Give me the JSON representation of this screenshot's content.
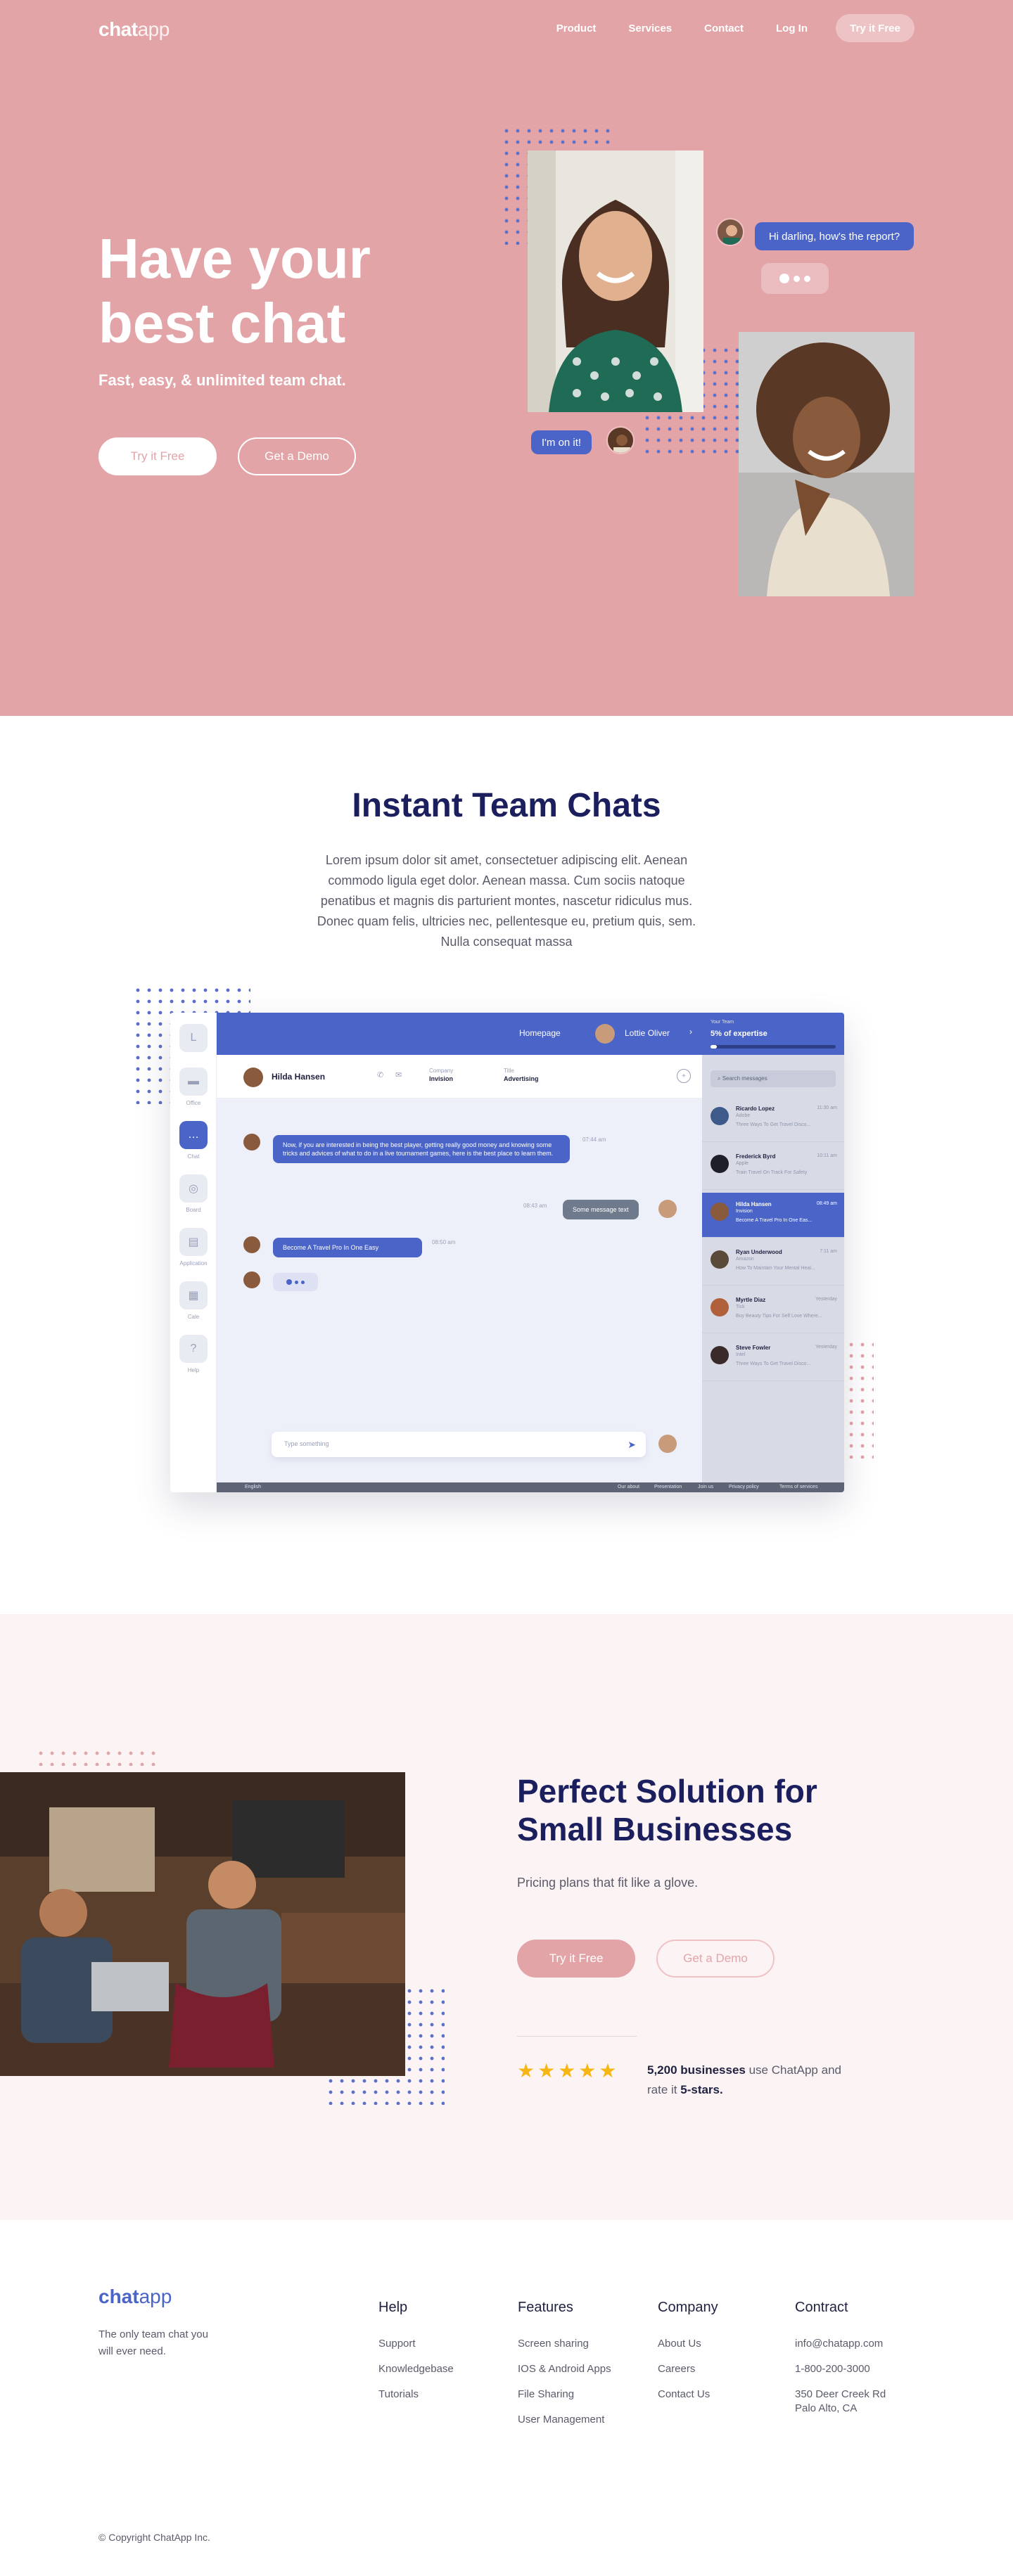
{
  "nav": {
    "logo_bold": "chat",
    "logo_light": "app",
    "links": [
      "Product",
      "Services",
      "Contact",
      "Log In"
    ],
    "cta": "Try it Free"
  },
  "hero": {
    "title": "Have your best chat",
    "subtitle": "Fast, easy, & unlimited team chat.",
    "primary_cta": "Try it Free",
    "secondary_cta": "Get a Demo",
    "bubble_question": "Hi darling, how's the report?",
    "bubble_reply": "I'm on it!"
  },
  "team_chats": {
    "title": "Instant Team Chats",
    "body": "Lorem ipsum dolor sit amet, consectetuer adipiscing elit. Aenean commodo ligula eget dolor. Aenean massa. Cum sociis natoque penatibus et magnis dis parturient montes, nascetur ridiculus mus. Donec quam felis, ultricies nec, pellentesque eu, pretium quis, sem. Nulla consequat massa"
  },
  "app_mock": {
    "sidebar": [
      "Office",
      "Chat",
      "Board",
      "Application",
      "Cale",
      "Help"
    ],
    "top_home": "Homepage",
    "top_user": "Lottie Oliver",
    "chat_name": "Hilda Hansen",
    "meta_company_label": "Company",
    "meta_company": "Invision",
    "meta_title_label": "Title",
    "meta_title": "Advertising",
    "messages": [
      {
        "text": "Now, if you are interested in being the best player, getting really good money and knowing some tricks and advices of what to do in a live tournament games, here is the best place to learn them.",
        "time": "07:44 am"
      },
      {
        "text": "Some message text",
        "time": "08:43 am"
      },
      {
        "text": "Become A Travel Pro In One Easy",
        "time": "08:50 am"
      }
    ],
    "input_placeholder": "Type something",
    "footer_lang": "English",
    "footer_links": [
      "Our about",
      "Presentation",
      "Join us",
      "Privacy policy",
      "Terms of services"
    ],
    "right_label": "Your Team",
    "right_title": "5% of expertise",
    "search_placeholder": "Search messages",
    "contacts": [
      {
        "name": "Ricardo Lopez",
        "company": "Adobe",
        "preview": "Three Ways To Get Travel Disco...",
        "time": "11:30 am",
        "color": "#3d5a8a"
      },
      {
        "name": "Frederick Byrd",
        "company": "Apple",
        "preview": "Train Travel On Track For Safety",
        "time": "10:11 am",
        "color": "#1f1f2a"
      },
      {
        "name": "Hilda Hansen",
        "company": "Invision",
        "preview": "Become A Travel Pro In One Eas...",
        "time": "08:49 am",
        "color": "#8a5a3c"
      },
      {
        "name": "Ryan Underwood",
        "company": "Amazon",
        "preview": "How To Maintain Your Mental Heal...",
        "time": "7:11 am",
        "color": "#5a4a3a"
      },
      {
        "name": "Myrtle Diaz",
        "company": "Tick",
        "preview": "Buy Beauty Tips For Self Love Where...",
        "time": "Yesterday",
        "color": "#b0603a"
      },
      {
        "name": "Steve Fowler",
        "company": "Intel",
        "preview": "Three Ways To Get Travel Disco...",
        "time": "Yesterday",
        "color": "#3a2a2a"
      }
    ]
  },
  "solution": {
    "title": "Perfect Solution for Small Businesses",
    "subtitle": "Pricing plans that fit like a glove.",
    "primary_cta": "Try it Free",
    "secondary_cta": "Get a Demo",
    "stars": "★★★★★",
    "rating_count": "5,200 businesses",
    "rating_mid": " use ChatApp and rate it ",
    "rating_score": "5-stars."
  },
  "footer": {
    "logo_bold": "chat",
    "logo_light": "app",
    "tagline": "The only team chat you will ever need.",
    "columns": [
      {
        "title": "Help",
        "items": [
          "Support",
          "Knowledgebase",
          "Tutorials"
        ]
      },
      {
        "title": "Features",
        "items": [
          "Screen sharing",
          "IOS & Android Apps",
          "File Sharing",
          "User Management"
        ]
      },
      {
        "title": "Company",
        "items": [
          "About Us",
          "Careers",
          "Contact Us"
        ]
      },
      {
        "title": "Contract",
        "items": [
          "info@chatapp.com",
          "1-800-200-3000",
          "350 Deer Creek Rd Palo Alto, CA"
        ]
      }
    ],
    "copyright": "© Copyright ChatApp Inc."
  },
  "colors": {
    "brand_pink": "#e3a4a8",
    "brand_blue": "#4a64c7",
    "navy": "#1c1f5e",
    "star": "#f6b614"
  }
}
